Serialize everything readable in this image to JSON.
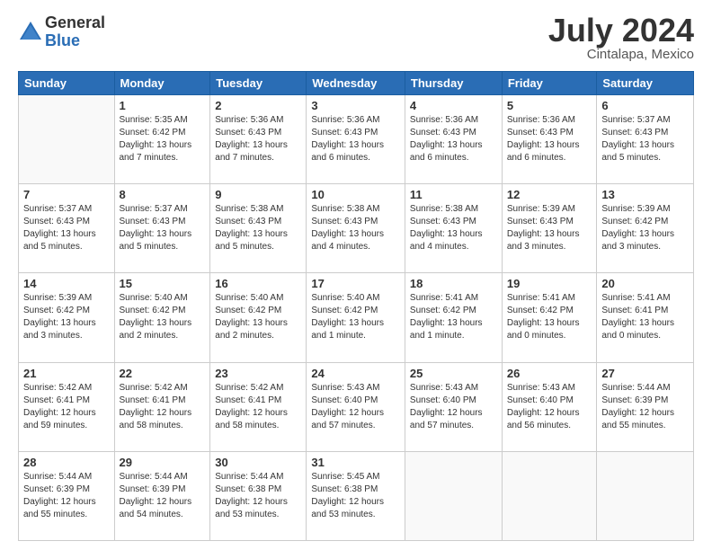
{
  "header": {
    "logo_general": "General",
    "logo_blue": "Blue",
    "month_title": "July 2024",
    "location": "Cintalapa, Mexico"
  },
  "weekdays": [
    "Sunday",
    "Monday",
    "Tuesday",
    "Wednesday",
    "Thursday",
    "Friday",
    "Saturday"
  ],
  "weeks": [
    [
      {
        "day": "",
        "empty": true
      },
      {
        "day": "1",
        "sunrise": "5:35 AM",
        "sunset": "6:42 PM",
        "daylight": "13 hours and 7 minutes."
      },
      {
        "day": "2",
        "sunrise": "5:36 AM",
        "sunset": "6:43 PM",
        "daylight": "13 hours and 7 minutes."
      },
      {
        "day": "3",
        "sunrise": "5:36 AM",
        "sunset": "6:43 PM",
        "daylight": "13 hours and 6 minutes."
      },
      {
        "day": "4",
        "sunrise": "5:36 AM",
        "sunset": "6:43 PM",
        "daylight": "13 hours and 6 minutes."
      },
      {
        "day": "5",
        "sunrise": "5:36 AM",
        "sunset": "6:43 PM",
        "daylight": "13 hours and 6 minutes."
      },
      {
        "day": "6",
        "sunrise": "5:37 AM",
        "sunset": "6:43 PM",
        "daylight": "13 hours and 5 minutes."
      }
    ],
    [
      {
        "day": "7",
        "sunrise": "5:37 AM",
        "sunset": "6:43 PM",
        "daylight": "13 hours and 5 minutes."
      },
      {
        "day": "8",
        "sunrise": "5:37 AM",
        "sunset": "6:43 PM",
        "daylight": "13 hours and 5 minutes."
      },
      {
        "day": "9",
        "sunrise": "5:38 AM",
        "sunset": "6:43 PM",
        "daylight": "13 hours and 5 minutes."
      },
      {
        "day": "10",
        "sunrise": "5:38 AM",
        "sunset": "6:43 PM",
        "daylight": "13 hours and 4 minutes."
      },
      {
        "day": "11",
        "sunrise": "5:38 AM",
        "sunset": "6:43 PM",
        "daylight": "13 hours and 4 minutes."
      },
      {
        "day": "12",
        "sunrise": "5:39 AM",
        "sunset": "6:43 PM",
        "daylight": "13 hours and 3 minutes."
      },
      {
        "day": "13",
        "sunrise": "5:39 AM",
        "sunset": "6:42 PM",
        "daylight": "13 hours and 3 minutes."
      }
    ],
    [
      {
        "day": "14",
        "sunrise": "5:39 AM",
        "sunset": "6:42 PM",
        "daylight": "13 hours and 3 minutes."
      },
      {
        "day": "15",
        "sunrise": "5:40 AM",
        "sunset": "6:42 PM",
        "daylight": "13 hours and 2 minutes."
      },
      {
        "day": "16",
        "sunrise": "5:40 AM",
        "sunset": "6:42 PM",
        "daylight": "13 hours and 2 minutes."
      },
      {
        "day": "17",
        "sunrise": "5:40 AM",
        "sunset": "6:42 PM",
        "daylight": "13 hours and 1 minute."
      },
      {
        "day": "18",
        "sunrise": "5:41 AM",
        "sunset": "6:42 PM",
        "daylight": "13 hours and 1 minute."
      },
      {
        "day": "19",
        "sunrise": "5:41 AM",
        "sunset": "6:42 PM",
        "daylight": "13 hours and 0 minutes."
      },
      {
        "day": "20",
        "sunrise": "5:41 AM",
        "sunset": "6:41 PM",
        "daylight": "13 hours and 0 minutes."
      }
    ],
    [
      {
        "day": "21",
        "sunrise": "5:42 AM",
        "sunset": "6:41 PM",
        "daylight": "12 hours and 59 minutes."
      },
      {
        "day": "22",
        "sunrise": "5:42 AM",
        "sunset": "6:41 PM",
        "daylight": "12 hours and 58 minutes."
      },
      {
        "day": "23",
        "sunrise": "5:42 AM",
        "sunset": "6:41 PM",
        "daylight": "12 hours and 58 minutes."
      },
      {
        "day": "24",
        "sunrise": "5:43 AM",
        "sunset": "6:40 PM",
        "daylight": "12 hours and 57 minutes."
      },
      {
        "day": "25",
        "sunrise": "5:43 AM",
        "sunset": "6:40 PM",
        "daylight": "12 hours and 57 minutes."
      },
      {
        "day": "26",
        "sunrise": "5:43 AM",
        "sunset": "6:40 PM",
        "daylight": "12 hours and 56 minutes."
      },
      {
        "day": "27",
        "sunrise": "5:44 AM",
        "sunset": "6:39 PM",
        "daylight": "12 hours and 55 minutes."
      }
    ],
    [
      {
        "day": "28",
        "sunrise": "5:44 AM",
        "sunset": "6:39 PM",
        "daylight": "12 hours and 55 minutes."
      },
      {
        "day": "29",
        "sunrise": "5:44 AM",
        "sunset": "6:39 PM",
        "daylight": "12 hours and 54 minutes."
      },
      {
        "day": "30",
        "sunrise": "5:44 AM",
        "sunset": "6:38 PM",
        "daylight": "12 hours and 53 minutes."
      },
      {
        "day": "31",
        "sunrise": "5:45 AM",
        "sunset": "6:38 PM",
        "daylight": "12 hours and 53 minutes."
      },
      {
        "day": "",
        "empty": true
      },
      {
        "day": "",
        "empty": true
      },
      {
        "day": "",
        "empty": true
      }
    ]
  ]
}
